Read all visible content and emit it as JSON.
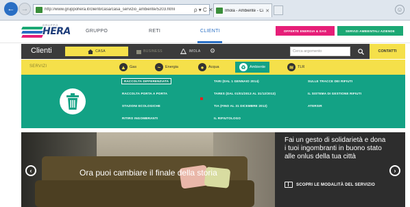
{
  "browser": {
    "url": "http://www.gruppohera.it/clienti/casa/casa_servizio_ambiente/5203.html",
    "address_controls": "ρ ▾ C ✕",
    "tab_title": "Imola - Ambiente - Casa - ...",
    "tab_close": "✕",
    "back": "←",
    "forward": "→",
    "settings": "☺"
  },
  "header": {
    "logo_group": "GRUPPO",
    "logo_text": "HERA",
    "logo_colors": [
      "#1ba874",
      "#2a6fc4",
      "#e61e78"
    ],
    "nav": [
      "GRUPPO",
      "RETI",
      "CLIENTI"
    ],
    "active_nav": "CLIENTI",
    "cta_primary": "OFFERTE ENERGIA & GAS",
    "cta_secondary": "SERVIZI AMBIENTALI AZIENDE"
  },
  "clienti_bar": {
    "title": "Clienti",
    "casa": "CASA",
    "business": "BUSINESS",
    "location": "IMOLA",
    "search_placeholder": "Cerca argomento",
    "contatti": "CONTATTI"
  },
  "servizi_bar": {
    "label": "SERVIZI",
    "items": [
      {
        "label": "Gas",
        "icon": "flame-icon"
      },
      {
        "label": "Energia",
        "icon": "energy-icon"
      },
      {
        "label": "Acqua",
        "icon": "water-drop-icon"
      },
      {
        "label": "Ambiente",
        "icon": "recycle-icon"
      },
      {
        "label": "TLR",
        "icon": "heating-icon"
      }
    ],
    "active": "Ambiente"
  },
  "ambiente_menu": {
    "col1": [
      "RACCOLTA DIFFERENZIATA",
      "RACCOLTA PORTA A PORTA",
      "STAZIONI ECOLOGICHE",
      "RITIRO INGOMBRANTI"
    ],
    "col2": [
      "TARI (DAL 1 GENNAIO 2014)",
      "TARES (DAL 01/01/2013 AL 31/12/2013)",
      "TIA (FINO AL 31 DICEMBRE 2012)",
      "IL RIFIUTOLOGO"
    ],
    "col3": [
      "SULLE TRACCE DEI RIFIUTI",
      "IL SISTEMA DI GESTIONE RIFIUTI",
      "ATERSIR"
    ],
    "selected": "RACCOLTA DIFFERENZIATA"
  },
  "hero": {
    "caption": "Ora puoi cambiare il finale della storia",
    "message": "Fai un gesto di solidarietà e dona i tuoi ingombranti in buono stato alle onlus della tua città",
    "link": "SCOPRI LE MODALITÀ DEL SERVIZIO",
    "prev": "‹",
    "next": "›"
  }
}
